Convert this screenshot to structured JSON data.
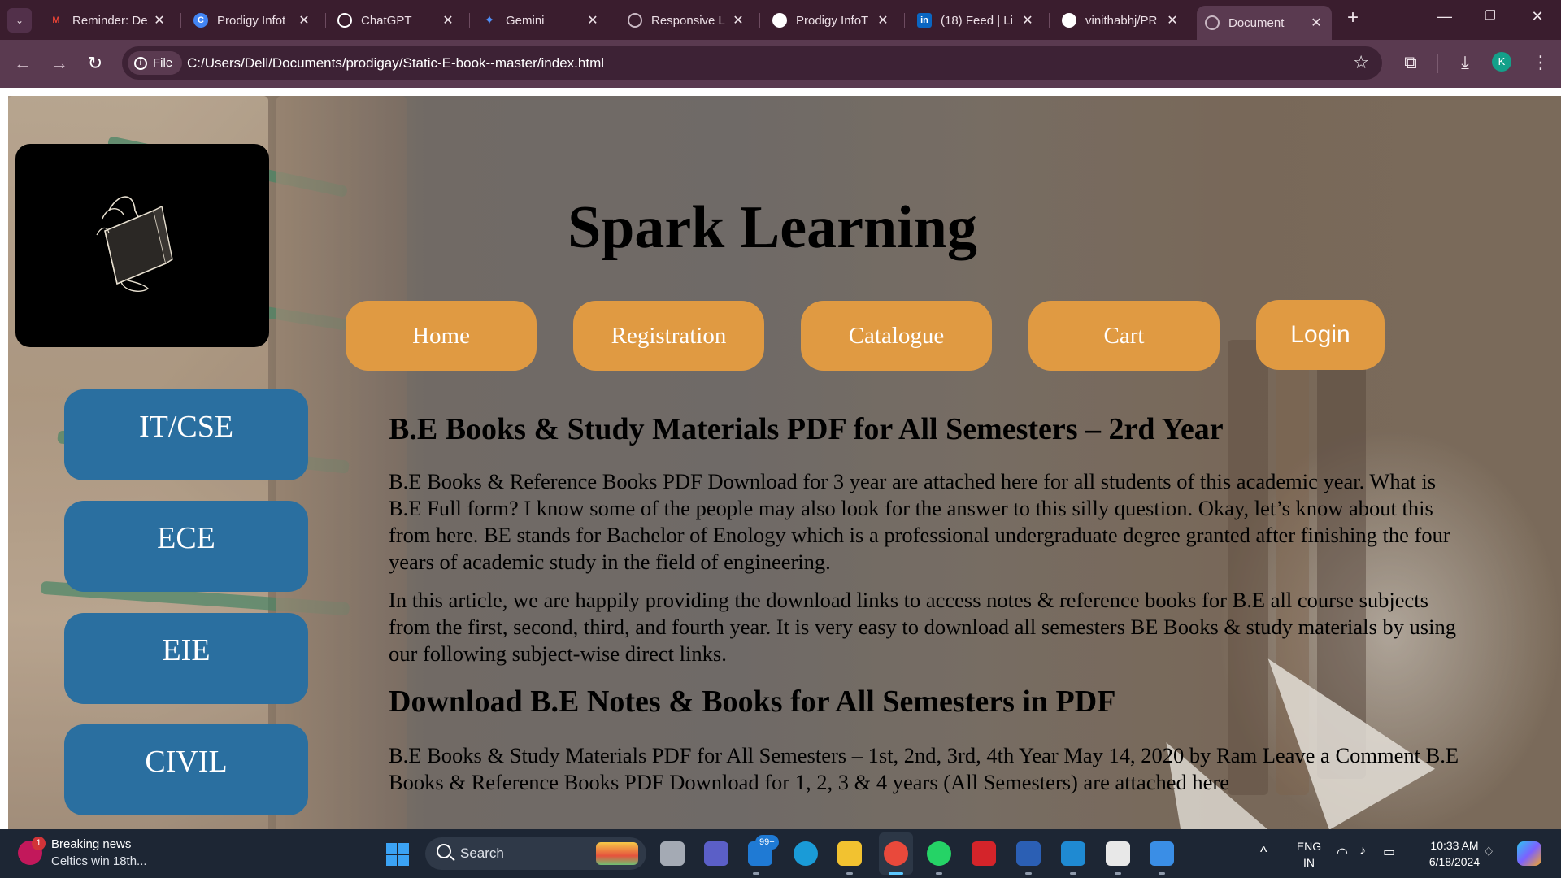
{
  "browser": {
    "tabs": [
      {
        "title": "Reminder: De",
        "icon": "gmail-icon",
        "color": "#ea4335"
      },
      {
        "title": "Prodigy Infot",
        "icon": "prodigy-icon",
        "color": "#4285f4"
      },
      {
        "title": "ChatGPT",
        "icon": "chatgpt-icon",
        "color": "#ffffff"
      },
      {
        "title": "Gemini",
        "icon": "gemini-icon",
        "color": "#4f8ff7"
      },
      {
        "title": "Responsive L",
        "icon": "globe-icon",
        "color": "#c9b8c3"
      },
      {
        "title": "Prodigy InfoT",
        "icon": "prodigy-icon",
        "color": "#ffffff"
      },
      {
        "title": "(18) Feed | Li",
        "icon": "linkedin-icon",
        "color": "#0a66c2"
      },
      {
        "title": "vinithabhj/PR",
        "icon": "github-icon",
        "color": "#ffffff"
      },
      {
        "title": "Document",
        "icon": "globe-icon",
        "color": "#c9b8c3"
      }
    ],
    "file_chip": "File",
    "url": "C:/Users/Dell/Documents/prodigay/Static-E-book--master/index.html",
    "profile_initial": "K"
  },
  "page": {
    "title": "Spark Learning",
    "nav": [
      "Home",
      "Registration",
      "Catalogue",
      "Cart",
      "Login"
    ],
    "departments": [
      "IT/CSE",
      "ECE",
      "EIE",
      "CIVIL"
    ],
    "heading1": "B.E Books & Study Materials PDF for All Semesters – 2rd Year",
    "para1": "B.E Books & Reference Books PDF Download for 3 year are attached here for all students of this academic year. What is B.E Full form? I know some of the people may also look for the answer to this silly question. Okay, let’s know about this from here. BE stands for Bachelor of Enology which is a professional undergraduate degree granted after finishing the four years of academic study in the field of engineering.",
    "para2": "In this article, we are happily providing the download links to access notes & reference books for B.E all course subjects from the first, second, third, and fourth year. It is very easy to download all semesters BE Books & study materials by using our following subject-wise direct links.",
    "heading2": "Download B.E Notes & Books for All Semesters in PDF",
    "para3": "B.E Books & Study Materials PDF for All Semesters – 1st, 2nd, 3rd, 4th Year May 14, 2020 by Ram Leave a Comment B.E Books & Reference Books PDF Download for 1, 2, 3 & 4 years (All Semesters) are attached here",
    "colors": {
      "nav": "#e09a42",
      "department": "#2a6fa0",
      "title": "#000000"
    }
  },
  "taskbar": {
    "news_title": "Breaking news",
    "news_sub": "Celtics win 18th...",
    "news_badge": "1",
    "search_label": "Search",
    "teams_badge": "99+",
    "lang": "ENG",
    "region": "IN",
    "time": "10:33 AM",
    "date": "6/18/2024"
  }
}
